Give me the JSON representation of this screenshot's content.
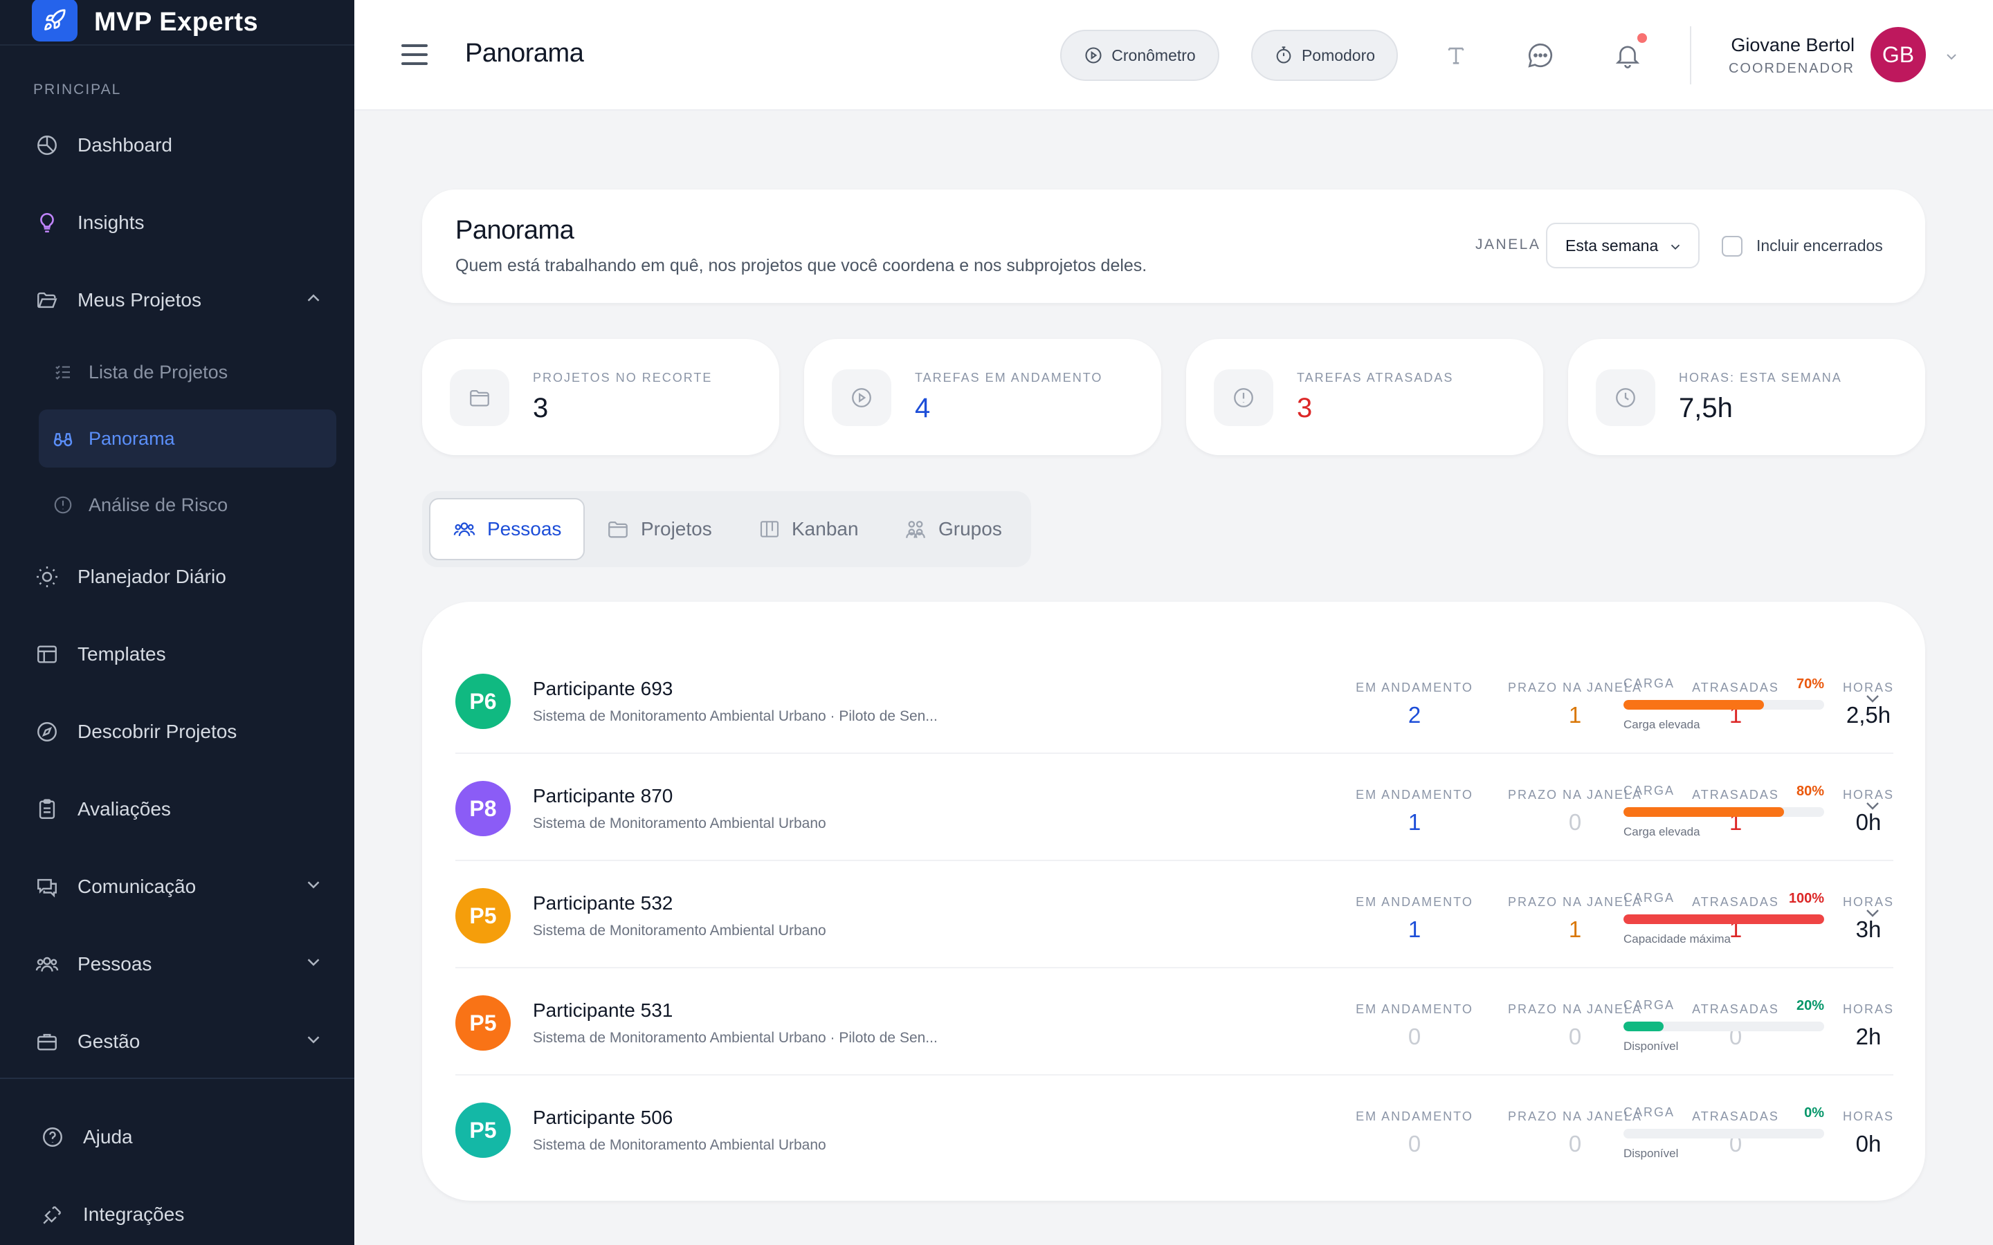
{
  "app": {
    "name": "MVP Experts"
  },
  "sidebar": {
    "section_label": "PRINCIPAL",
    "items": [
      {
        "label": "Dashboard",
        "icon": "pie-chart-icon"
      },
      {
        "label": "Insights",
        "icon": "lightbulb-icon"
      },
      {
        "label": "Meus Projetos",
        "icon": "folder-open-icon",
        "expanded": true
      },
      {
        "label": "Lista de Projetos",
        "icon": "checklist-icon"
      },
      {
        "label": "Panorama",
        "icon": "binoculars-icon",
        "active": true
      },
      {
        "label": "Análise de Risco",
        "icon": "alert-circle-icon"
      },
      {
        "label": "Planejador Diário",
        "icon": "sun-icon"
      },
      {
        "label": "Templates",
        "icon": "layout-icon"
      },
      {
        "label": "Descobrir Projetos",
        "icon": "compass-icon"
      },
      {
        "label": "Avaliações",
        "icon": "clipboard-icon"
      },
      {
        "label": "Comunicação",
        "icon": "chat-icon"
      },
      {
        "label": "Pessoas",
        "icon": "users-icon"
      },
      {
        "label": "Gestão",
        "icon": "briefcase-icon"
      }
    ],
    "footer": [
      {
        "label": "Ajuda",
        "icon": "help-circle-icon"
      },
      {
        "label": "Integrações",
        "icon": "plug-icon"
      }
    ]
  },
  "topbar": {
    "title": "Panorama",
    "cronometro_label": "Cronômetro",
    "pomodoro_label": "Pomodoro",
    "user_name": "Giovane Bertol",
    "user_role": "COORDENADOR",
    "user_initials": "GB"
  },
  "header": {
    "title": "Panorama",
    "subtitle": "Quem está trabalhando em quê, nos projetos que você coordena e nos subprojetos deles.",
    "janela_label": "JANELA",
    "janela_value": "Esta semana",
    "include_closed_label": "Incluir encerrados",
    "include_closed_checked": false
  },
  "stats": [
    {
      "label": "PROJETOS NO RECORTE",
      "value": "3",
      "color": "#111827",
      "icon": "folder-icon"
    },
    {
      "label": "TAREFAS EM ANDAMENTO",
      "value": "4",
      "color": "#1d4ed8",
      "icon": "play-circle-icon"
    },
    {
      "label": "TAREFAS ATRASADAS",
      "value": "3",
      "color": "#dc2626",
      "icon": "alert-circle-icon"
    },
    {
      "label": "HORAS: ESTA SEMANA",
      "value": "7,5h",
      "color": "#111827",
      "icon": "clock-icon"
    }
  ],
  "tabs": [
    {
      "label": "Pessoas",
      "icon": "users-icon",
      "active": true
    },
    {
      "label": "Projetos",
      "icon": "folder-icon"
    },
    {
      "label": "Kanban",
      "icon": "kanban-icon"
    },
    {
      "label": "Grupos",
      "icon": "groups-icon"
    }
  ],
  "metric_labels": {
    "em_andamento": "EM ANDAMENTO",
    "prazo": "PRAZO NA JANELA",
    "atrasadas": "ATRASADAS",
    "horas": "HORAS",
    "carga": "CARGA"
  },
  "people": [
    {
      "initials": "P6",
      "avatar_color": "#10b981",
      "name": "Participante 693",
      "projects": "Sistema de Monitoramento Ambiental Urbano · Piloto de Sen...",
      "em_andamento": "2",
      "prazo": "1",
      "atrasadas": "1",
      "horas": "2,5h",
      "carga_pct": "70%",
      "carga": 0.7,
      "carga_color": "#f97316",
      "carga_status": "Carga elevada",
      "expandable": true
    },
    {
      "initials": "P8",
      "avatar_color": "#8b5cf6",
      "name": "Participante 870",
      "projects": "Sistema de Monitoramento Ambiental Urbano",
      "em_andamento": "1",
      "prazo": "0",
      "atrasadas": "1",
      "horas": "0h",
      "carga_pct": "80%",
      "carga": 0.8,
      "carga_color": "#f97316",
      "carga_status": "Carga elevada",
      "expandable": true
    },
    {
      "initials": "P5",
      "avatar_color": "#f59e0b",
      "name": "Participante 532",
      "projects": "Sistema de Monitoramento Ambiental Urbano",
      "em_andamento": "1",
      "prazo": "1",
      "atrasadas": "1",
      "horas": "3h",
      "carga_pct": "100%",
      "carga": 1.0,
      "carga_color": "#ef4444",
      "carga_status": "Capacidade máxima",
      "expandable": true
    },
    {
      "initials": "P5",
      "avatar_color": "#f97316",
      "name": "Participante 531",
      "projects": "Sistema de Monitoramento Ambiental Urbano · Piloto de Sen...",
      "em_andamento": "0",
      "prazo": "0",
      "atrasadas": "0",
      "horas": "2h",
      "carga_pct": "20%",
      "carga": 0.2,
      "carga_color": "#10b981",
      "carga_status": "Disponível",
      "expandable": false
    },
    {
      "initials": "P5",
      "avatar_color": "#14b8a6",
      "name": "Participante 506",
      "projects": "Sistema de Monitoramento Ambiental Urbano",
      "em_andamento": "0",
      "prazo": "0",
      "atrasadas": "0",
      "horas": "0h",
      "carga_pct": "0%",
      "carga": 0.0,
      "carga_color": "#10b981",
      "carga_status": "Disponível",
      "expandable": false
    }
  ],
  "colors": {
    "accent": "#2563eb",
    "sidebar_bg": "#141c2c",
    "blue_value": "#1d4ed8",
    "orange_value": "#d97706",
    "red_value": "#dc2626",
    "zero_value": "#c9cdd4"
  }
}
